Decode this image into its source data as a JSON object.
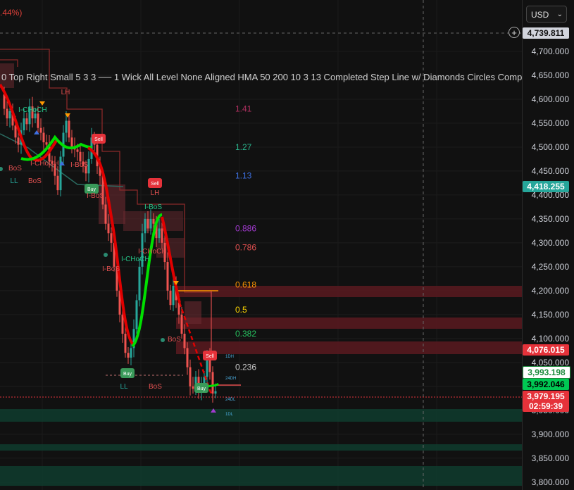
{
  "header": {
    "change_pct": ".44%)",
    "indicator_caption": "0 Top Right Small 5 3 3 ── 1 Wick All Level None Aligned HMA 50 200 10 3 13 Completed Step Line w/ Diamonds Circles Comp"
  },
  "price_axis": {
    "currency": "USD",
    "ticks": [
      "4,700.000",
      "4,650.000",
      "4,600.000",
      "4,550.000",
      "4,500.000",
      "4,450.000",
      "4,400.000",
      "4,350.000",
      "4,300.000",
      "4,250.000",
      "4,200.000",
      "4,150.000",
      "4,100.000",
      "4,050.000",
      "3,950.000",
      "3,900.000",
      "3,850.000",
      "3,800.000"
    ],
    "tick_values": [
      4700,
      4650,
      4600,
      4550,
      4500,
      4450,
      4400,
      4350,
      4300,
      4250,
      4200,
      4150,
      4100,
      4050,
      3950,
      3900,
      3850,
      3800
    ],
    "crosshair_price": "4,739.811",
    "tags": {
      "level_4418": "4,418.255",
      "level_4076": "4,076.015",
      "level_3993": "3,993.198",
      "level_3992": "3,992.046",
      "last_price": "3,979.195",
      "countdown": "02:59:39"
    }
  },
  "fib_levels": [
    {
      "label": "1.41",
      "price": 4580,
      "color": "#b03060"
    },
    {
      "label": "1.27",
      "price": 4500,
      "color": "#2ab08a"
    },
    {
      "label": "1.13",
      "price": 4440,
      "color": "#3d6fe0"
    },
    {
      "label": "0.886",
      "price": 4330,
      "color": "#a23ad0"
    },
    {
      "label": "0.786",
      "price": 4290,
      "color": "#e05050"
    },
    {
      "label": "0.618",
      "price": 4212,
      "color": "#ff9800"
    },
    {
      "label": "0.5",
      "price": 4160,
      "color": "#ffd700"
    },
    {
      "label": "0.382",
      "price": 4110,
      "color": "#27c460"
    },
    {
      "label": "0.236",
      "price": 4040,
      "color": "#c8c8c8"
    }
  ],
  "signals": {
    "sell_1": "Sell",
    "sell_2": "Sell",
    "sell_3": "Sell",
    "buy_1": "Buy",
    "buy_2": "Buy",
    "buy_3": "Buy"
  },
  "annotations": {
    "lh_1": "LH",
    "lh_2": "LH",
    "ll": "LL",
    "ll_2": "LL",
    "choch_1": "I-CHoCH",
    "choch_2": "I-CHoCH",
    "choch_3": "I-CHoCH",
    "choch_4": "I-CHoCH",
    "bos_1": "BoS",
    "bos_2": "I-BoS",
    "bos_3": "I-BoS",
    "bos_4": "I-BoS",
    "bos_5": "I-BoS",
    "bos_6": "BoS",
    "bos_7": "BoS",
    "bos_8": "I-BoS",
    "lvl_1dh": "1DH",
    "lvl_24h": "24DH",
    "lvl_24l": "24DL",
    "lvl_1dl": "1DL"
  },
  "colors": {
    "bull": "#26a69a",
    "bear": "#ef5350",
    "hma_up": "#00e000",
    "hma_down": "#e00000",
    "zone_red": "#5a1a20",
    "zone_green": "#0f3a2c"
  }
}
